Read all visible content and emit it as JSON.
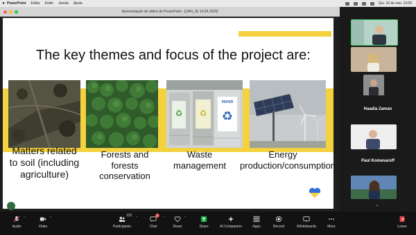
{
  "menubar": {
    "app_name": "PowerPoint",
    "items": [
      "Editar",
      "Exibir",
      "Janela",
      "Ajuda"
    ],
    "datetime": "Qui. 16 de mar. 13:00"
  },
  "window": {
    "title": "Apresentação de slides do PowerPoint - [UAN_JE 14.05.2020]"
  },
  "slide": {
    "title": "The key themes and focus of the project are:",
    "themes": [
      {
        "caption": "Matters related to soil (including agriculture)"
      },
      {
        "caption": "Forests and forests conservation"
      },
      {
        "caption": "Waste management"
      },
      {
        "caption": "Energy production/consumption"
      }
    ],
    "bin_label": "PAPER",
    "colors": {
      "accent": "#f4d23f",
      "ukraine_blue": "#2f6fdc",
      "ukraine_yellow": "#f4d23f"
    }
  },
  "gallery": {
    "participants": [
      {
        "name": ""
      },
      {
        "name": ""
      },
      {
        "name": "Haadia Zaman"
      },
      {
        "name": "Paul Komesaroff"
      },
      {
        "name": ""
      }
    ]
  },
  "toolbar": {
    "audio": "Audio",
    "video": "Video",
    "participants": "Participants",
    "participants_count": "132",
    "chat": "Chat",
    "chat_badge": "1",
    "react": "React",
    "share": "Share",
    "ai_companion": "AI Companion",
    "apps": "Apps",
    "record": "Record",
    "whiteboards": "Whiteboards",
    "more": "More",
    "leave": "Leave"
  }
}
